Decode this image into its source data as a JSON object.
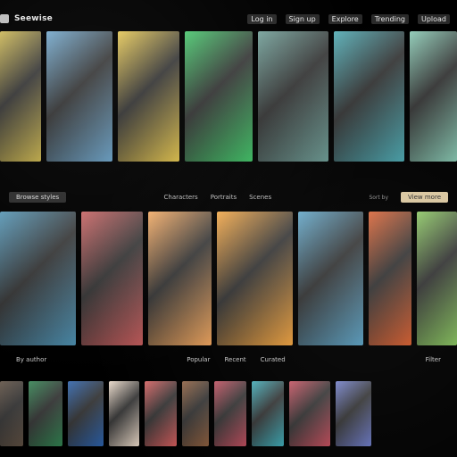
{
  "header": {
    "brand": "Seewise",
    "menu": [
      "Log in",
      "Sign up",
      "Explore",
      "Trending",
      "Upload"
    ]
  },
  "section_a": {
    "left_button": "Browse styles",
    "middle_links": [
      "Characters",
      "Portraits",
      "Scenes"
    ],
    "right_text": "Sort by",
    "right_button": "View more"
  },
  "section_b": {
    "left_text": "By author",
    "center_left": "Popular",
    "center_mid": "Recent",
    "center_right": "Curated",
    "right_text": "Filter"
  },
  "colors": {
    "row1": [
      "#c8b24b",
      "#6aa2c8",
      "#e2c24a",
      "#3cc163",
      "#6a9a93",
      "#4aa7b0",
      "#86c7b1"
    ],
    "row2": [
      "#4c8fb0",
      "#c45a5a",
      "#f1a55c",
      "#f1a23d",
      "#5aa1c4",
      "#d85d2d",
      "#86c35c"
    ],
    "row3": [
      "#5b4c3f",
      "#2f7f4e",
      "#2a5fa8",
      "#e8d7c6",
      "#d05a5a",
      "#8a5b3b",
      "#bb4a5a",
      "#3aa7b3",
      "#c24b5a",
      "#6b79c6"
    ]
  }
}
